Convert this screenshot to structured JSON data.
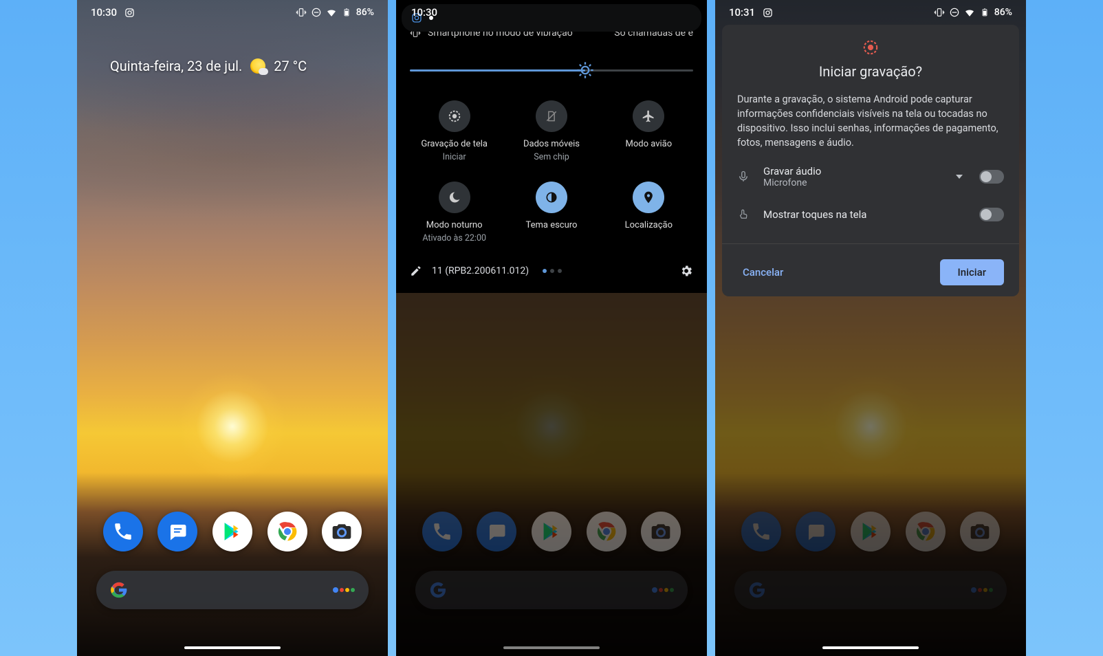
{
  "statusbar": {
    "time1": "10:30",
    "time2": "10:30",
    "time3": "10:31",
    "battery": "86%"
  },
  "home": {
    "date_text": "Quinta-feira, 23 de jul.",
    "temp": "27 °C",
    "dock": {
      "phone": "Telefone",
      "messages": "Mensagens",
      "play": "Play Store",
      "chrome": "Chrome",
      "camera": "Câmera"
    }
  },
  "qs": {
    "vibrate_text": "Smartphone no modo de vibração",
    "calls_only": "Só chamadas de e",
    "tiles": {
      "record_title": "Gravação de tela",
      "record_sub": "Iniciar",
      "data_title": "Dados móveis",
      "data_sub": "Sem chip",
      "airplane_title": "Modo avião",
      "night_title": "Modo noturno",
      "night_sub": "Ativado às 22:00",
      "dark_title": "Tema escuro",
      "location_title": "Localização"
    },
    "build": "11 (RPB2.200611.012)"
  },
  "dialog": {
    "title": "Iniciar gravação?",
    "body": "Durante a gravação, o sistema Android pode capturar informações confidenciais visíveis na tela ou tocadas no dispositivo. Isso inclui senhas, informações de pagamento, fotos, mensagens e áudio.",
    "audio_title": "Gravar áudio",
    "audio_sub": "Microfone",
    "touches_title": "Mostrar toques na tela",
    "cancel": "Cancelar",
    "start": "Iniciar"
  }
}
